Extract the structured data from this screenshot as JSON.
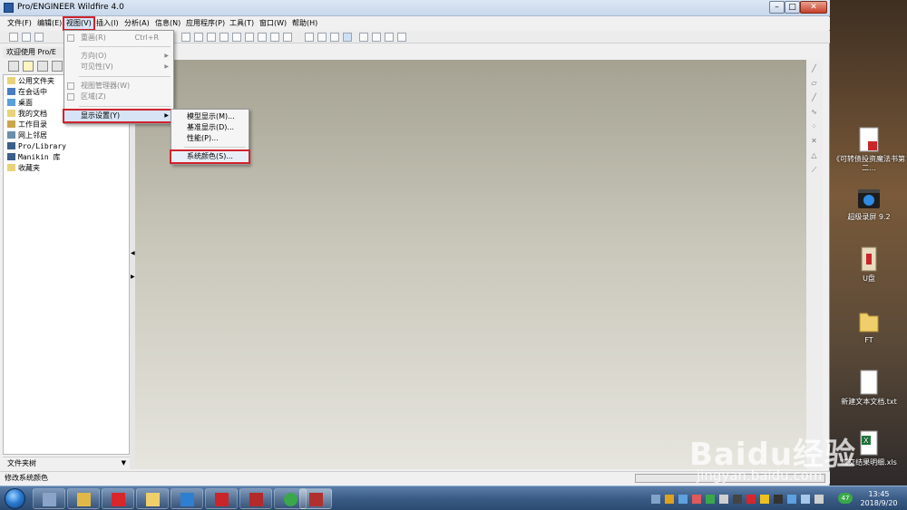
{
  "window": {
    "title": "Pro/ENGINEER Wildfire 4.0",
    "controls": {
      "minimize": "–",
      "maximize": "□",
      "close": "✕"
    }
  },
  "menubar": {
    "items": [
      {
        "label": "文件(F)"
      },
      {
        "label": "编辑(E)"
      },
      {
        "label": "视图(V)"
      },
      {
        "label": "插入(I)"
      },
      {
        "label": "分析(A)"
      },
      {
        "label": "信息(N)"
      },
      {
        "label": "应用程序(P)"
      },
      {
        "label": "工具(T)"
      },
      {
        "label": "窗口(W)"
      },
      {
        "label": "帮助(H)"
      }
    ]
  },
  "view_menu": {
    "items": [
      {
        "label": "重画(R)",
        "shortcut": "Ctrl+R",
        "enabled": false
      },
      {
        "label": "方向(O)",
        "enabled": false
      },
      {
        "label": "可见性(V)",
        "enabled": false
      },
      {
        "label": "视图管理器(W)",
        "enabled": false
      },
      {
        "label": "区域(Z)",
        "enabled": false
      },
      {
        "label": "显示设置(Y)",
        "enabled": true
      }
    ]
  },
  "display_submenu": {
    "items": [
      {
        "label": "模型显示(M)..."
      },
      {
        "label": "基准显示(D)..."
      },
      {
        "label": "性能(P)..."
      },
      {
        "label": "系统颜色(S)..."
      }
    ]
  },
  "navigator": {
    "tab_label": "欢迎使用 Pro/E",
    "tree_items": [
      {
        "label": "公用文件夹",
        "icon": "folder-icon"
      },
      {
        "label": "在会话中",
        "icon": "session-icon"
      },
      {
        "label": "桌面",
        "icon": "desktop-icon"
      },
      {
        "label": "我的文档",
        "icon": "documents-icon"
      },
      {
        "label": "工作目录",
        "icon": "working-directory-icon"
      },
      {
        "label": "网上邻居",
        "icon": "network-icon"
      },
      {
        "label": "Pro/Library",
        "icon": "library-icon"
      },
      {
        "label": "Manikin 库",
        "icon": "manikin-icon"
      },
      {
        "label": "收藏夹",
        "icon": "favorites-icon"
      }
    ],
    "footer_label": "文件夹树"
  },
  "status": {
    "text": "修改系统颜色"
  },
  "desktop_icons": [
    {
      "label": "《可转债投资魔法书第二..."
    },
    {
      "label": "超级录屏 9.2"
    },
    {
      "label": "U盘"
    },
    {
      "label": "FT"
    },
    {
      "label": "新建文本文档.txt"
    },
    {
      "label": "成交结果明细.xls"
    }
  ],
  "taskbar": {
    "time": "13:45",
    "date": "2018/9/20",
    "badge": "47"
  },
  "watermark": {
    "brand": "Baidu经验",
    "url": "jingyan.baidu.com"
  },
  "colors": {
    "highlight_border": "#d0242e",
    "menu_highlight": "#d6e4f5",
    "viewport_top": "#a5a292",
    "viewport_bottom": "#e6e5de"
  }
}
